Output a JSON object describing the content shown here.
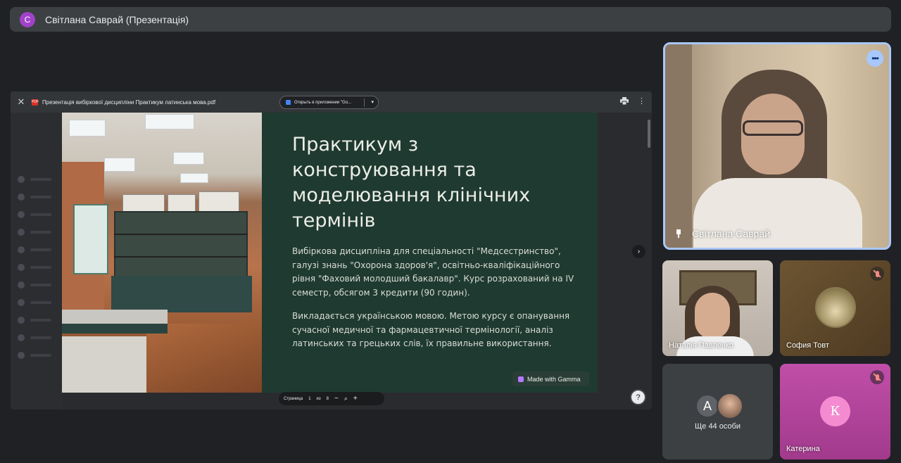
{
  "header": {
    "avatar_letter": "С",
    "title": "Світлана Саврай (Презентація)"
  },
  "presentation": {
    "pdf_title": "Презентація вибіркової дисципліни Практикум латинська мова.pdf",
    "pdf_icon_text": "PDF",
    "open_in_app": "Открыть в приложении \"Go...",
    "slide": {
      "title": "Практикум з конструювання та моделювання клінічних термінів",
      "paragraph1": "Вибіркова дисципліна для спеціальності \"Медсестринство\", галузі знань \"Охорона здоров'я\", освітньо-кваліфікаційного рівня \"Фаховий молодший бакалавр\". Курс розрахований на IV семестр, обсягом 3 кредити (90 годин).",
      "paragraph2": "Викладається українською мовою. Метою курсу є опанування сучасної медичної та фармацевтичної термінології, аналіз латинських та грецьких слів, їх правильне використання.",
      "badge": "Made with Gamma"
    },
    "page_bar": {
      "label": "Страница",
      "current": "1",
      "of": "из",
      "total": "8",
      "minus": "−",
      "plus": "+"
    }
  },
  "speaker": {
    "name": "Світлана Саврай"
  },
  "participants": [
    {
      "name": "Наталія Павленко"
    },
    {
      "name": "София Товт"
    },
    {
      "avatar_letter": "A",
      "more": "Ще 44 особи"
    },
    {
      "avatar_letter": "К",
      "name": "Катерина"
    }
  ],
  "colors": {
    "accent_border": "#a8c7fa",
    "slide_bg": "#1f3a30",
    "tile_pink": "#b44a9c"
  }
}
